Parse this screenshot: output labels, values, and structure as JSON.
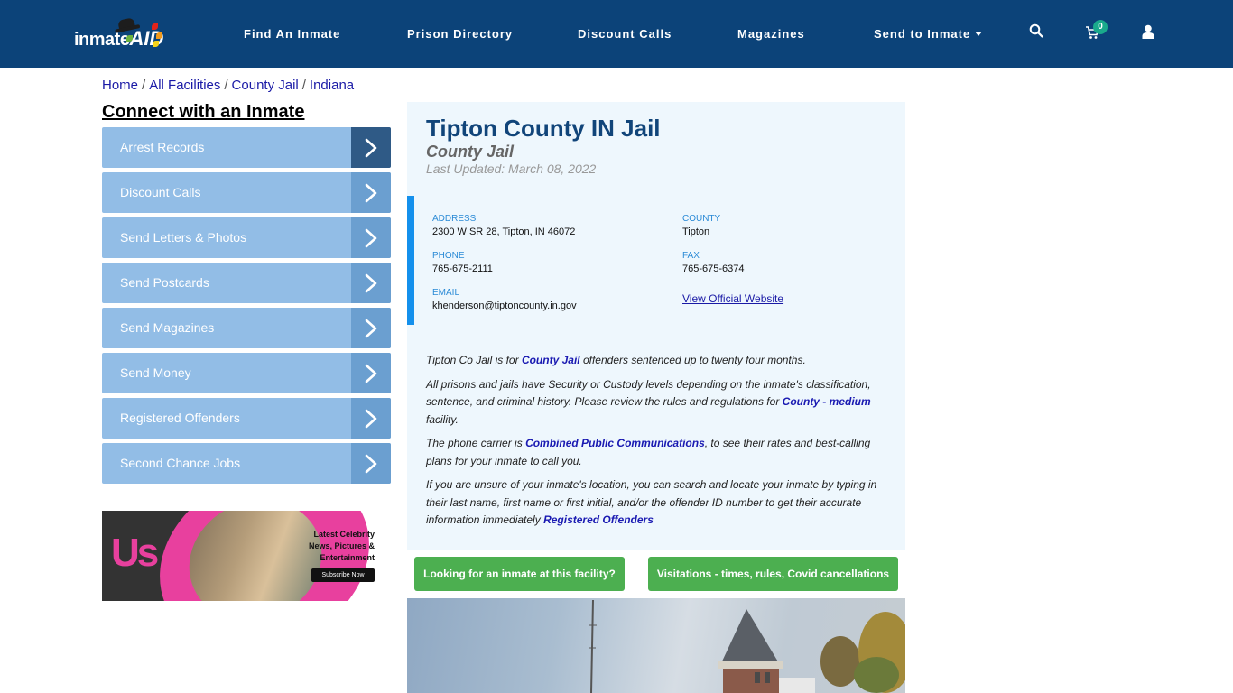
{
  "header": {
    "logo": {
      "text_inmate": "inmate",
      "text_aid": "AID"
    },
    "nav": [
      {
        "label": "Find An Inmate"
      },
      {
        "label": "Prison Directory"
      },
      {
        "label": "Discount Calls"
      },
      {
        "label": "Magazines"
      },
      {
        "label": "Send to Inmate",
        "has_dropdown": true
      }
    ],
    "icons": {
      "search": "search-icon",
      "cart": "cart-icon",
      "user": "user-icon"
    },
    "cart_count": "0"
  },
  "breadcrumb": [
    {
      "label": "Home"
    },
    {
      "label": "All Facilities"
    },
    {
      "label": "County Jail"
    },
    {
      "label": "Indiana"
    }
  ],
  "breadcrumb_separator": "/",
  "sidebar": {
    "title": "Connect with an Inmate",
    "items": [
      {
        "label": "Arrest Records"
      },
      {
        "label": "Discount Calls"
      },
      {
        "label": "Send Letters & Photos"
      },
      {
        "label": "Send Postcards"
      },
      {
        "label": "Send Magazines"
      },
      {
        "label": "Send Money"
      },
      {
        "label": "Registered Offenders"
      },
      {
        "label": "Second Chance Jobs"
      }
    ],
    "ad": {
      "brand": "Us",
      "headline_1": "Latest Celebrity",
      "headline_2": "News, Pictures &",
      "headline_3": "Entertainment",
      "button": "Subscribe Now"
    }
  },
  "facility": {
    "title": "Tipton County IN Jail",
    "type": "County Jail",
    "last_updated": "Last Updated: March 08, 2022",
    "info": {
      "address_label": "ADDRESS",
      "address": "2300 W SR 28, Tipton, IN 46072",
      "county_label": "COUNTY",
      "county": "Tipton",
      "phone_label": "PHONE",
      "phone": "765-675-2111",
      "fax_label": "FAX",
      "fax": "765-675-6374",
      "email_label": "EMAIL",
      "email": "khenderson@tiptoncounty.in.gov",
      "website_link": "View Official Website"
    },
    "description": {
      "p1_a": "Tipton Co Jail is for ",
      "p1_link": "County Jail",
      "p1_b": " offenders sentenced up to twenty four months.",
      "p2_a": "All prisons and jails have Security or Custody levels depending on the inmate's classification, sentence, and criminal history. Please review the rules and regulations for ",
      "p2_link": "County - medium",
      "p2_b": " facility.",
      "p3_a": "The phone carrier is ",
      "p3_link": "Combined Public Communications",
      "p3_b": ", to see their rates and best-calling plans for your inmate to call you.",
      "p4_a": "If you are unsure of your inmate's location, you can search and locate your inmate by typing in their last name, first name or first initial, and/or the offender ID number to get their accurate information immediately ",
      "p4_link": "Registered Offenders"
    },
    "buttons": {
      "find_inmate": "Looking for an inmate at this facility?",
      "visitations": "Visitations - times, rules, Covid cancellations"
    }
  },
  "colors": {
    "header_bg": "#0c4379",
    "sidebar_item": "#92bde6",
    "sidebar_chevron": "#6b9fd0",
    "sidebar_chevron_active": "#2f5a86",
    "panel_bg": "#eef7fd",
    "accent_bar": "#1490ec",
    "button_green": "#4caf50",
    "cart_badge": "#1aaa8c"
  }
}
